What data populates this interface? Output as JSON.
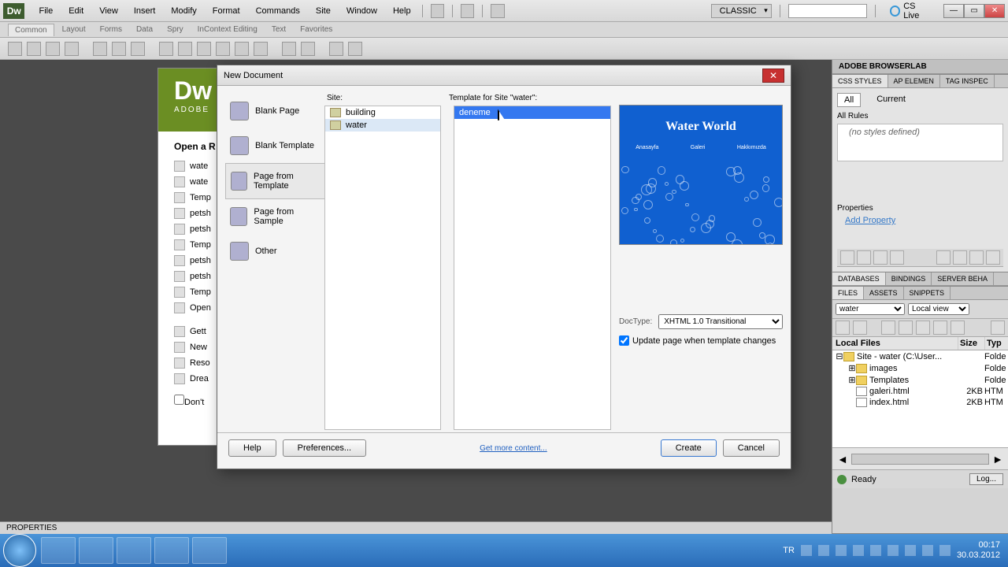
{
  "app": {
    "icon_text": "Dw"
  },
  "menubar": [
    "File",
    "Edit",
    "View",
    "Insert",
    "Modify",
    "Format",
    "Commands",
    "Site",
    "Window",
    "Help"
  ],
  "workspace": {
    "label": "CLASSIC",
    "cslive": "CS Live"
  },
  "insert_tabs": [
    "Common",
    "Layout",
    "Forms",
    "Data",
    "Spry",
    "InContext Editing",
    "Text",
    "Favorites"
  ],
  "welcome": {
    "logo": "Dw",
    "adobe": "ADOBE",
    "open_heading": "Open a R",
    "recent": [
      "wate",
      "wate",
      "Temp",
      "petsh",
      "petsh",
      "Temp",
      "petsh",
      "petsh",
      "Temp",
      "Open"
    ],
    "extras": [
      "Gett",
      "New",
      "Reso",
      "Drea"
    ],
    "dont": "Don't"
  },
  "dialog": {
    "title": "New Document",
    "categories": [
      "Blank Page",
      "Blank Template",
      "Page from Template",
      "Page from Sample",
      "Other"
    ],
    "selected_category_index": 2,
    "site_label": "Site:",
    "sites": [
      "building",
      "water"
    ],
    "selected_site_index": 1,
    "template_label": "Template for Site \"water\":",
    "templates": [
      "deneme"
    ],
    "selected_template_index": 0,
    "preview": {
      "title": "Water World",
      "nav": [
        "Anasayfa",
        "Galeri",
        "Hakkımızda"
      ]
    },
    "doctype_label": "DocType:",
    "doctype_value": "XHTML 1.0 Transitional",
    "update_label": "Update page when template changes",
    "update_checked": true,
    "buttons": {
      "help": "Help",
      "prefs": "Preferences...",
      "more": "Get more content...",
      "create": "Create",
      "cancel": "Cancel"
    }
  },
  "right": {
    "browserlab": "ADOBE BROWSERLAB",
    "css_tabs": [
      "CSS STYLES",
      "AP ELEMEN",
      "TAG INSPEC"
    ],
    "css_sub": {
      "all": "All",
      "current": "Current"
    },
    "all_rules": "All Rules",
    "no_styles": "(no styles defined)",
    "properties_heading": "Properties",
    "add_property": "Add Property",
    "db_tabs": [
      "DATABASES",
      "BINDINGS",
      "SERVER BEHA"
    ],
    "files_tabs": [
      "FILES",
      "ASSETS",
      "SNIPPETS"
    ],
    "site_select": "water",
    "view_select": "Local view",
    "tree_header": {
      "name": "Local Files",
      "size": "Size",
      "type": "Typ"
    },
    "tree": [
      {
        "indent": 0,
        "exp": "⊟",
        "icon": "folder",
        "name": "Site - water (C:\\User...",
        "size": "",
        "type": "Folde"
      },
      {
        "indent": 1,
        "exp": "⊞",
        "icon": "folder",
        "name": "images",
        "size": "",
        "type": "Folde"
      },
      {
        "indent": 1,
        "exp": "⊞",
        "icon": "folder",
        "name": "Templates",
        "size": "",
        "type": "Folde"
      },
      {
        "indent": 1,
        "exp": "",
        "icon": "file",
        "name": "galeri.html",
        "size": "2KB",
        "type": "HTM"
      },
      {
        "indent": 1,
        "exp": "",
        "icon": "file",
        "name": "index.html",
        "size": "2KB",
        "type": "HTM"
      }
    ],
    "status": {
      "ready": "Ready",
      "log": "Log..."
    }
  },
  "props_panel": "PROPERTIES",
  "taskbar": {
    "lang": "TR",
    "time": "00:17",
    "date": "30.03.2012"
  }
}
